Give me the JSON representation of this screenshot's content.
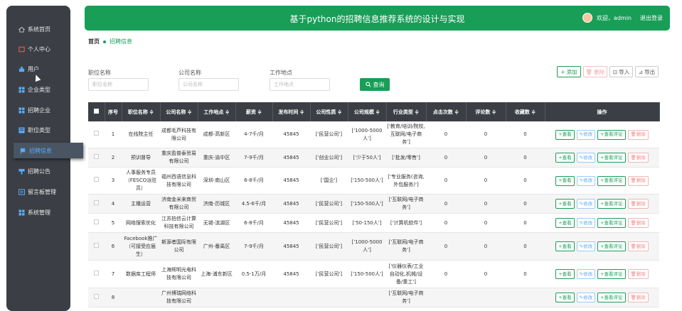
{
  "sidebar": {
    "items": [
      {
        "label": "系统首页",
        "icon": "home-icon"
      },
      {
        "label": "个人中心",
        "icon": "user-center-icon"
      },
      {
        "label": "用户",
        "icon": "users-icon"
      },
      {
        "label": "企业类型",
        "icon": "grid-icon"
      },
      {
        "label": "招聘企业",
        "icon": "grid-icon"
      },
      {
        "label": "职位类型",
        "icon": "list-icon"
      },
      {
        "label": "招聘信息",
        "icon": "flag-icon",
        "active": true
      },
      {
        "label": "招聘公告",
        "icon": "megaphone-icon"
      },
      {
        "label": "留言板管理",
        "icon": "message-icon"
      },
      {
        "label": "系统管理",
        "icon": "grid-icon"
      }
    ]
  },
  "header": {
    "title": "基于python的招聘信息推荐系统的设计与实现",
    "welcome": "欢迎，admin",
    "logout": "退出登录"
  },
  "breadcrumb": {
    "home": "首页",
    "current": "招聘信息"
  },
  "filters": {
    "job_label": "职位名称",
    "job_placeholder": "职位名称",
    "company_label": "公司名称",
    "company_placeholder": "公司名称",
    "location_label": "工作地点",
    "location_placeholder": "工作地点",
    "search_label": "查询"
  },
  "toolbar": {
    "add": "添加",
    "delete": "删除",
    "import": "导入",
    "export": "导出"
  },
  "table": {
    "headers": [
      "序号",
      "职位名称 ≑",
      "公司名称 ≑",
      "工作地点 ≑",
      "薪资 ≑",
      "发布时间 ≑",
      "公司性质 ≑",
      "公司规模 ≑",
      "行业类型 ≑",
      "点击次数 ≑",
      "评论数 ≑",
      "收藏数 ≑",
      "操作"
    ],
    "rows": [
      [
        "1",
        "在线院主任",
        "成都毛芦科技有限公司",
        "成都-高新区",
        "4-7千/月",
        "45845",
        "['民营公司']",
        "['1000-5000人']",
        "['教育/培训/院校,互联网/电子商务']",
        "0",
        "0",
        "0"
      ],
      [
        "2",
        "预训督导",
        "重庆盈普泰贸易有限公司",
        "重庆-渝中区",
        "7-9千/月",
        "45845",
        "['创业公司']",
        "['少于50人']",
        "['批发/零售']",
        "0",
        "0",
        "0"
      ],
      [
        "3",
        "人事服务专员（FESCO派驻员）",
        "福州西语信息科技有限公司",
        "深圳-南山区",
        "6-8千/月",
        "45845",
        "['国企']",
        "['150-500人']",
        "['专业服务(咨询,外包服务)']",
        "0",
        "0",
        "0"
      ],
      [
        "4",
        "主播运营",
        "济南金米来商贸有限公司",
        "济南-历城区",
        "4.5-6千/月",
        "45845",
        "['民营公司']",
        "['150-500人']",
        "['互联网/电子商务']",
        "0",
        "0",
        "0"
      ],
      [
        "5",
        "网络搜索优化",
        "江苏拍信云计算科技有限公司",
        "无锡-滨湖区",
        "6-8千/月",
        "45845",
        "['民营公司']",
        "['50-150人']",
        "['计算机软件']",
        "0",
        "0",
        "0"
      ],
      [
        "6",
        "Facebook推广（可接受应届生）",
        "斯源者国际有限公司",
        "广州-番禺区",
        "7-9千/月",
        "45845",
        "['民营公司']",
        "['1000-5000人']",
        "['互联网/电子商务']",
        "0",
        "0",
        "0"
      ],
      [
        "7",
        "数据库工程师",
        "上海辉明光电科技有限公司",
        "上海-浦东新区",
        "0.5-1万/月",
        "45845",
        "['民营公司']",
        "['150-500人']",
        "['仪器仪表/工业自动化,机械/设备/重工']",
        "0",
        "0",
        "0"
      ],
      [
        "8",
        "",
        "广州博瑞网络科技有限公司",
        "",
        "",
        "",
        "",
        "",
        "['互联网/电子商务']",
        "",
        "",
        ""
      ]
    ],
    "actions": {
      "view": "查看",
      "edit": "修改",
      "review": "查看评论",
      "delete": "删除"
    }
  },
  "colors": {
    "accent": "#189e57",
    "sidebar": "#3b3f45",
    "header": "#3b3f45"
  }
}
